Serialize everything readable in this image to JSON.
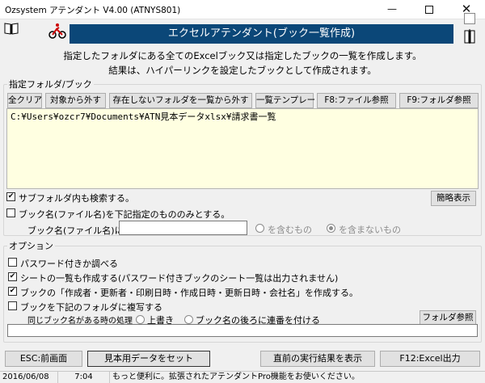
{
  "window": {
    "title": "Ozsystem アテンダント V4.00 (ATNYS801)"
  },
  "banner": {
    "title": "エクセルアテンダント(ブック一覧作成)"
  },
  "description": {
    "line1": "指定したフォルダにある全てのExcelブック又は指定したブックの一覧を作成します。",
    "line2": "結果は、ハイパーリンクを設定したブックとして作成されます。"
  },
  "folder_group": {
    "legend": "指定フォルダ/ブック",
    "buttons": {
      "clear_all": "全クリア",
      "remove": "対象から外す",
      "remove_missing": "存在しないフォルダを一覧から外す",
      "template": "一覧テンプレート",
      "file_ref": "F8:ファイル参照",
      "folder_ref": "F9:フォルダ参照"
    },
    "path_value": "C:¥Users¥ozcr7¥Documents¥ATN見本データxlsx¥請求書一覧",
    "subfolder_label": "サブフォルダ内も検索する。",
    "subfolder_checked": true,
    "simple_view": "簡略表示",
    "bookname_filter_label": "ブック名(ファイル名)を下記指定のもののみとする。",
    "bookname_filter_checked": false,
    "bookname_field_label": "ブック名(ファイル名)に",
    "bookname_value": "",
    "radio_include": "を含むもの",
    "radio_exclude": "を含まないもの"
  },
  "options": {
    "legend": "オプション",
    "items": [
      {
        "label": "パスワード付きか調べる",
        "checked": false
      },
      {
        "label": "シートの一覧も作成する(パスワード付きブックのシート一覧は出力されません)",
        "checked": true
      },
      {
        "label": "ブックの「作成者・更新者・印刷日時・作成日時・更新日時・会社名」を作成する。",
        "checked": true
      },
      {
        "label": "ブックを下記のフォルダに複写する",
        "checked": false
      }
    ],
    "same_name_label": "同じブック名がある時の処理",
    "overwrite_label": "上書き",
    "serial_label": "ブック名の後ろに連番を付ける",
    "folder_ref": "フォルダ参照",
    "copy_path": ""
  },
  "footer": {
    "esc": "ESC:前画面",
    "sample": "見本用データをセット",
    "last_result": "直前の実行結果を表示",
    "excel_out": "F12:Excel出力"
  },
  "status": {
    "date": "2016/06/08",
    "time": "7:04",
    "message": "もっと便利に。拡張されたアテンダントPro機能をお使いください。"
  }
}
